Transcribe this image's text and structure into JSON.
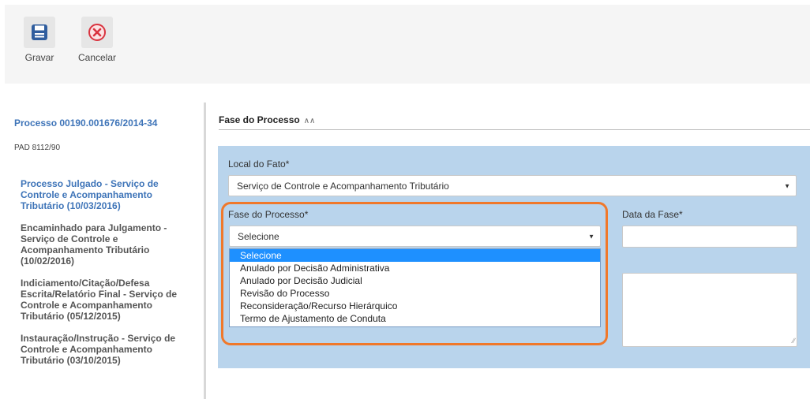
{
  "toolbar": {
    "save_label": "Gravar",
    "cancel_label": "Cancelar",
    "save_icon": "save-icon",
    "cancel_icon": "cancel-icon",
    "save_color": "#2f5d9e",
    "cancel_color": "#d9333f"
  },
  "sidebar": {
    "process_title": "Processo 00190.001676/2014-34",
    "pad": "PAD 8112/90",
    "timeline": [
      {
        "text": "Processo Julgado - Serviço de Controle e Acompanhamento Tributário (10/03/2016)"
      },
      {
        "text": "Encaminhado para Julgamento - Serviço de Controle e Acompanhamento Tributário (10/02/2016)"
      },
      {
        "text": "Indiciamento/Citação/Defesa Escrita/Relatório Final - Serviço de Controle e Acompanhamento Tributário (05/12/2015)"
      },
      {
        "text": "Instauração/Instrução - Serviço de Controle e Acompanhamento Tributário (03/10/2015)"
      }
    ]
  },
  "main": {
    "section_title": "Fase do Processo",
    "local_label": "Local do Fato*",
    "local_value": "Serviço de Controle e Acompanhamento Tributário",
    "fase_label": "Fase do Processo*",
    "fase_value": "Selecione",
    "data_label": "Data da Fase*",
    "fase_options": [
      "Selecione",
      "Anulado por Decisão Administrativa",
      "Anulado por Decisão Judicial",
      "Revisão do Processo",
      "Reconsideração/Recurso Hierárquico",
      "Termo de Ajustamento de Conduta"
    ]
  },
  "colors": {
    "accent": "#3e74b8",
    "panel": "#b9d4ec",
    "highlight": "#f0782a",
    "selected_option": "#1e90ff"
  }
}
